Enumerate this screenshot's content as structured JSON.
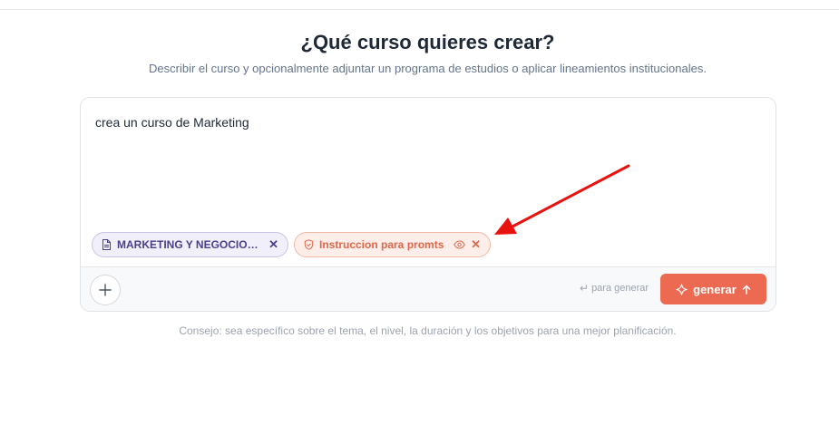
{
  "header": {
    "title": "¿Qué curso quieres crear?",
    "subtitle": "Describir el curso y opcionalmente adjuntar un programa de estudios o aplicar lineamientos institucionales."
  },
  "editor": {
    "prompt_value": "crea un curso de Marketing"
  },
  "attachments": [
    {
      "label": "MARKETING Y NEGOCIOS DIGITALES",
      "icon": "document-icon",
      "remove_label": "✕"
    },
    {
      "label": "Instruccion para promts",
      "icon": "shield-icon",
      "preview_icon": "eye-icon",
      "remove_label": "✕"
    }
  ],
  "footer": {
    "add_icon": "plus-icon",
    "hint_symbol": "↵",
    "hint_text": "para generar",
    "generate_label": "generar",
    "generate_icon": "sparkle-icon",
    "generate_arrow_icon": "arrow-up-icon"
  },
  "tip": "Consejo: sea específico sobre el tema, el nivel, la duración y los objetivos para una mejor planificación.",
  "colors": {
    "accent": "#ec6a52",
    "doc_chip": "#4c3f8a",
    "annotation_arrow": "#e8120f"
  }
}
